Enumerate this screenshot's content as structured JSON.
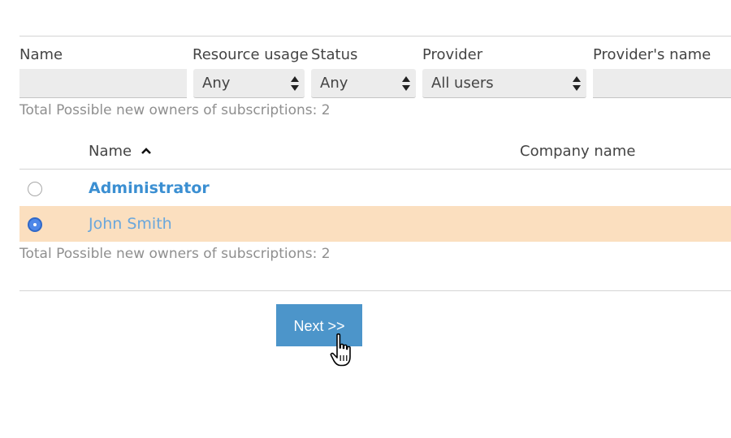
{
  "filters": {
    "name": {
      "label": "Name",
      "value": ""
    },
    "resource_usage": {
      "label": "Resource usage",
      "value": "Any"
    },
    "status": {
      "label": "Status",
      "value": "Any"
    },
    "provider": {
      "label": "Provider",
      "value": "All users"
    },
    "providers_name": {
      "label": "Provider's name",
      "value": ""
    }
  },
  "total_top": "Total Possible new owners of subscriptions: 2",
  "table": {
    "columns": {
      "name": "Name",
      "company": "Company name"
    },
    "sort_icon": "caret-up-icon",
    "rows": [
      {
        "name": "Administrator",
        "company": "",
        "selected": false
      },
      {
        "name": "John Smith",
        "company": "",
        "selected": true
      }
    ]
  },
  "total_bottom": "Total Possible new owners of subscriptions: 2",
  "next_label": "Next >>",
  "colors": {
    "link": "#3b8fd2",
    "selected_row": "#fbdfbf",
    "button": "#4c95ca",
    "radio_checked": "#4e87e8"
  }
}
